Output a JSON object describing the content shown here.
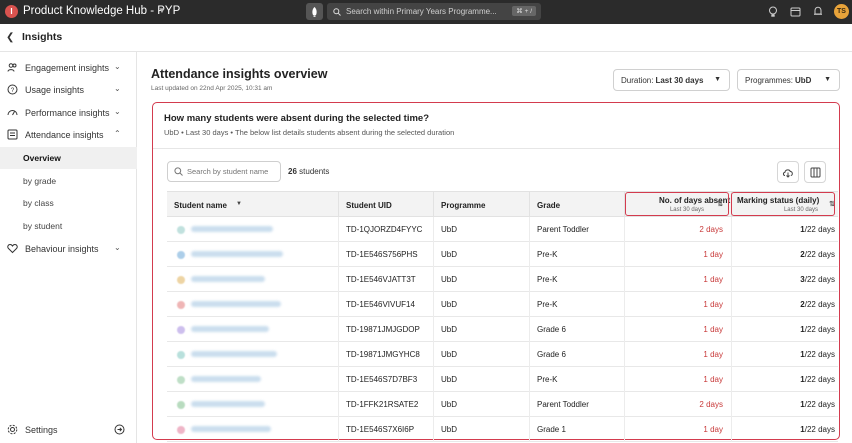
{
  "app": {
    "logo_letter": "I",
    "title": "Product Knowledge Hub - PYP",
    "search_placeholder": "Search within Primary Years Programme...",
    "shortcut": "⌘ + /",
    "user_initials": "TS"
  },
  "subheader": {
    "title": "Insights"
  },
  "sidebar": {
    "items": [
      {
        "label": "Engagement insights",
        "icon": "people-icon",
        "chevron": "⌄"
      },
      {
        "label": "Usage insights",
        "icon": "question-circle-icon",
        "chevron": "⌄"
      },
      {
        "label": "Performance insights",
        "icon": "gauge-icon",
        "chevron": "⌄"
      },
      {
        "label": "Attendance insights",
        "icon": "calendar-list-icon",
        "chevron": "⌃"
      }
    ],
    "attendance_sub": [
      {
        "label": "Overview",
        "active": true
      },
      {
        "label": "by grade",
        "active": false
      },
      {
        "label": "by class",
        "active": false
      },
      {
        "label": "by student",
        "active": false
      }
    ],
    "behaviour": {
      "label": "Behaviour insights",
      "icon": "heart-icon",
      "chevron": "⌄"
    },
    "settings": {
      "label": "Settings"
    }
  },
  "main": {
    "title": "Attendance insights overview",
    "updated": "Last updated on 22nd Apr 2025, 10:31 am",
    "duration_label": "Duration:",
    "duration_value": "Last 30 days",
    "programmes_label": "Programmes:",
    "programmes_value": "UbD"
  },
  "card": {
    "question": "How many students were absent during the selected time?",
    "subtitle": "UbD  •  Last 30 days  •  The below list details students absent during the selected duration",
    "search_placeholder": "Search by student name",
    "count": "26",
    "count_suffix": "students"
  },
  "table": {
    "headers": {
      "name": "Student name",
      "uid": "Student UID",
      "programme": "Programme",
      "grade": "Grade",
      "absent": "No. of days absent",
      "absent_sub": "Last 30 days",
      "marking": "Marking status (daily)",
      "marking_sub": "Last 30 days"
    },
    "rows": [
      {
        "uid": "TD-1QJORZD4FYYC",
        "programme": "UbD",
        "grade": "Parent Toddler",
        "absent": "2 days",
        "mark_n": "1",
        "mark_d": "/22 days",
        "color": "#8fc9c4"
      },
      {
        "uid": "TD-1E546S756PHS",
        "programme": "UbD",
        "grade": "Pre-K",
        "absent": "1 day",
        "mark_n": "2",
        "mark_d": "/22 days",
        "color": "#6aa7d8"
      },
      {
        "uid": "TD-1E546VJATT3T",
        "programme": "UbD",
        "grade": "Pre-K",
        "absent": "1 day",
        "mark_n": "3",
        "mark_d": "/22 days",
        "color": "#e0b25a"
      },
      {
        "uid": "TD-1E546VIVUF14",
        "programme": "UbD",
        "grade": "Pre-K",
        "absent": "1 day",
        "mark_n": "2",
        "mark_d": "/22 days",
        "color": "#e27a7a"
      },
      {
        "uid": "TD-19871JMJGDOP",
        "programme": "UbD",
        "grade": "Grade 6",
        "absent": "1 day",
        "mark_n": "1",
        "mark_d": "/22 days",
        "color": "#a68ce0"
      },
      {
        "uid": "TD-19871JMGYHC8",
        "programme": "UbD",
        "grade": "Grade 6",
        "absent": "1 day",
        "mark_n": "1",
        "mark_d": "/22 days",
        "color": "#7fc7c0"
      },
      {
        "uid": "TD-1E546S7D7BF3",
        "programme": "UbD",
        "grade": "Pre-K",
        "absent": "1 day",
        "mark_n": "1",
        "mark_d": "/22 days",
        "color": "#8cc59a"
      },
      {
        "uid": "TD-1FFK21RSATE2",
        "programme": "UbD",
        "grade": "Parent Toddler",
        "absent": "2 days",
        "mark_n": "1",
        "mark_d": "/22 days",
        "color": "#7fbf8c"
      },
      {
        "uid": "TD-1E546S7X6I6P",
        "programme": "UbD",
        "grade": "Grade 1",
        "absent": "1 day",
        "mark_n": "1",
        "mark_d": "/22 days",
        "color": "#e27a9a"
      }
    ]
  },
  "colors": {
    "accent": "#d33b4e",
    "absent": "#c83a3a",
    "topbar": "#2b2b2b"
  }
}
